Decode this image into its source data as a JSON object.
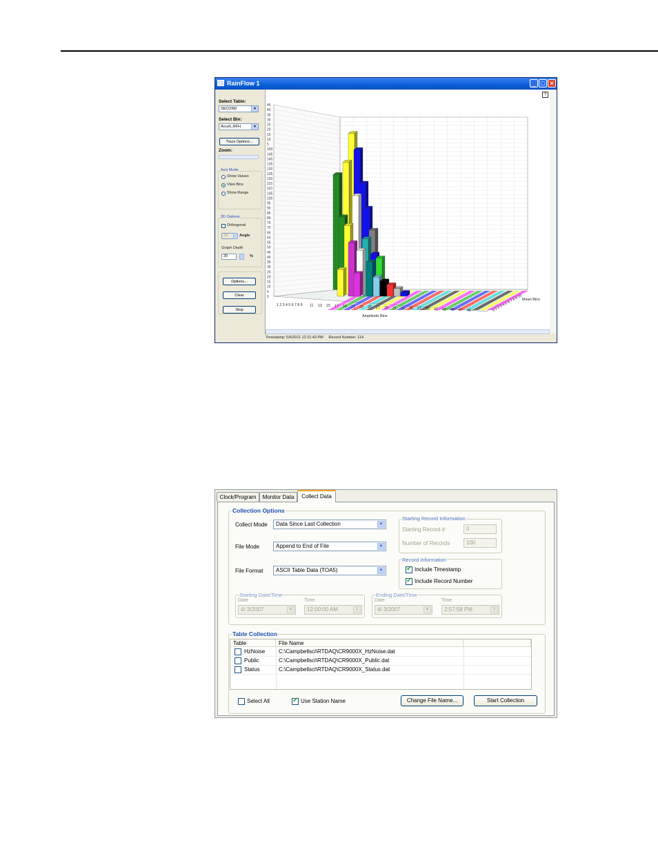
{
  "rainflow": {
    "title": "RainFlow 1",
    "help_label": "?",
    "select_table_label": "Select Table:",
    "select_table_value": "SECOND",
    "select_bin_label": "Select Bin:",
    "select_bin_value": "Accell_RFH",
    "trace_options_label": "Trace Options...",
    "zoom_label": "Zoom:",
    "axis_mode_label": "Axis Mode",
    "axis_modes": [
      "Show Values",
      "View Bins",
      "Show Range"
    ],
    "axis_mode_selected": "View Bins",
    "options_3d_label": "3D Options",
    "orthogonal_label": "Orthogonal",
    "angle_value": "24",
    "angle_label": "Angle",
    "graph_depth_label": "Graph Depth",
    "graph_depth_value": "20",
    "percent_label": "%",
    "options_button": "Options...",
    "clear_button": "Clear",
    "stop_button": "Stop",
    "status_timestamp": "Timestamp: 5/6/2011 12:21:43 PM",
    "status_record": "Record Number: 114",
    "accent_color": "#0a5fd8"
  },
  "chart_data": {
    "type": "bar",
    "projection": "3d",
    "xlabel": "Amplitude Bins",
    "zlabel": "Mean Bins",
    "ylim": [
      0,
      45
    ],
    "y_ticks": [
      "0",
      "5",
      "10",
      "15",
      "20",
      "25",
      "30",
      "35",
      "40",
      "45",
      "50",
      "55",
      "60",
      "65",
      "70",
      "75",
      "80",
      "85",
      "90",
      "95",
      "100",
      "105",
      "110",
      "115",
      "120",
      "125",
      "130",
      "135",
      "140",
      "145",
      "150",
      "5",
      "10",
      "15",
      "20",
      "25",
      "30",
      "35",
      "40",
      "45"
    ],
    "x_tick_labels": [
      "1 2 3 4 5 6 7 8 9",
      "11",
      "13",
      "15",
      "17",
      "19",
      "21",
      "23",
      "25",
      "27",
      "29",
      "31",
      "33",
      "35",
      "37",
      "39",
      "41",
      "43",
      "45",
      "47",
      "49"
    ],
    "z_tick_label": "0 1 2 3 4 5 6 7 8 9 10",
    "bars": [
      {
        "h": 40,
        "color": "#ffff33"
      },
      {
        "h": 36,
        "color": "#1111ee"
      },
      {
        "h": 33,
        "color": "#ffff33"
      },
      {
        "h": 30,
        "color": "#228b22"
      },
      {
        "h": 28,
        "color": "#1111ee"
      },
      {
        "h": 25,
        "color": "#ffffff"
      },
      {
        "h": 22,
        "color": "#1111ee"
      },
      {
        "h": 20,
        "color": "#228b22"
      },
      {
        "h": 18,
        "color": "#ffff33"
      },
      {
        "h": 17,
        "color": "#808080"
      },
      {
        "h": 15,
        "color": "#20b2aa"
      },
      {
        "h": 14,
        "color": "#cc33cc"
      },
      {
        "h": 12,
        "color": "#ffffff"
      },
      {
        "h": 11,
        "color": "#1111ee"
      },
      {
        "h": 10,
        "color": "#33dd33"
      },
      {
        "h": 9,
        "color": "#008080"
      },
      {
        "h": 7,
        "color": "#ffff33"
      },
      {
        "h": 6,
        "color": "#dd33dd"
      },
      {
        "h": 5,
        "color": "#87ceeb"
      },
      {
        "h": 4,
        "color": "#000000"
      },
      {
        "h": 3,
        "color": "#ff3333"
      },
      {
        "h": 2,
        "color": "#c0c0c0"
      },
      {
        "h": 1,
        "color": "#1111ee"
      }
    ]
  },
  "collect": {
    "tabs": [
      "Clock/Program",
      "Monitor Data",
      "Collect Data"
    ],
    "active_tab": "Collect Data",
    "collection_options_title": "Collection Options",
    "collect_mode_label": "Collect Mode",
    "collect_mode_value": "Data Since Last Collection",
    "file_mode_label": "File Mode",
    "file_mode_value": "Append to End of File",
    "file_format_label": "File Format",
    "file_format_value": "ASCII Table Data (TOA5)",
    "starting_record_title": "Starting Record Information",
    "starting_record_label": "Starting Record #",
    "starting_record_value": "0",
    "number_records_label": "Number of Records",
    "number_records_value": "100",
    "record_info_title": "Record Information",
    "include_timestamp_label": "Include Timestamp",
    "include_record_number_label": "Include Record Number",
    "start_dt_title": "Starting Date/Time",
    "end_dt_title": "Ending Date/Time",
    "date_label": "Date",
    "time_label": "Time",
    "start_date": "4/  3/2007",
    "start_time": "12:00:00 AM",
    "end_date": "4/  3/2007",
    "end_time": "2:57:58 PM",
    "table_collection_title": "Table Collection",
    "col_table": "Table",
    "col_file": "File Name",
    "rows": [
      {
        "table": "HzNoise",
        "file": "C:\\Campbellsci\\RTDAQ\\CR9000X_HzNoise.dat"
      },
      {
        "table": "Public",
        "file": "C:\\Campbellsci\\RTDAQ\\CR9000X_Public.dat"
      },
      {
        "table": "Status",
        "file": "C:\\Campbellsci\\RTDAQ\\CR9000X_Status.dat"
      }
    ],
    "select_all_label": "Select All",
    "use_station_name_label": "Use Station Name",
    "change_file_name_button": "Change File Name...",
    "start_collection_button": "Start Collection"
  }
}
